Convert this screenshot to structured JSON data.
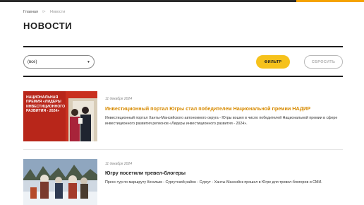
{
  "breadcrumb": {
    "home": "Главная",
    "separator": "⊳",
    "current": "Новости"
  },
  "page_title": "НОВОСТИ",
  "filter": {
    "select_value": "(все)",
    "filter_button": "ФИЛЬТР",
    "reset_button": "СБРОСИТЬ"
  },
  "colors": {
    "accent": "#f6c21c",
    "headline_orange": "#d78a00",
    "dark": "#1e1e1e"
  },
  "news": [
    {
      "date": "11 декабря 2024",
      "title": "Инвестиционный портал Югры стал победителем Национальной премии НАДИР",
      "excerpt": "Инвестиционный портал Ханты-Мансийского автономного округа - Югры вошел в число победителей Национальной премии в сфере инвестиционного развития регионов «Лидеры инвестиционного развития - 2024».",
      "image_caption": "НАЦИОНАЛЬНАЯ ПРЕМИЯ «ЛИДЕРЫ ИНВЕСТИЦИОННОГО РАЗВИТИЯ - 2024»"
    },
    {
      "date": "11 декабря 2024",
      "title": "Югру посетили тревел-блогеры",
      "excerpt": "Пресс-тур по маршруту Когалым - Сургутский район - Сургут - Ханты-Мансийск прошел в Югре для тревел-блогеров и СМИ."
    }
  ]
}
